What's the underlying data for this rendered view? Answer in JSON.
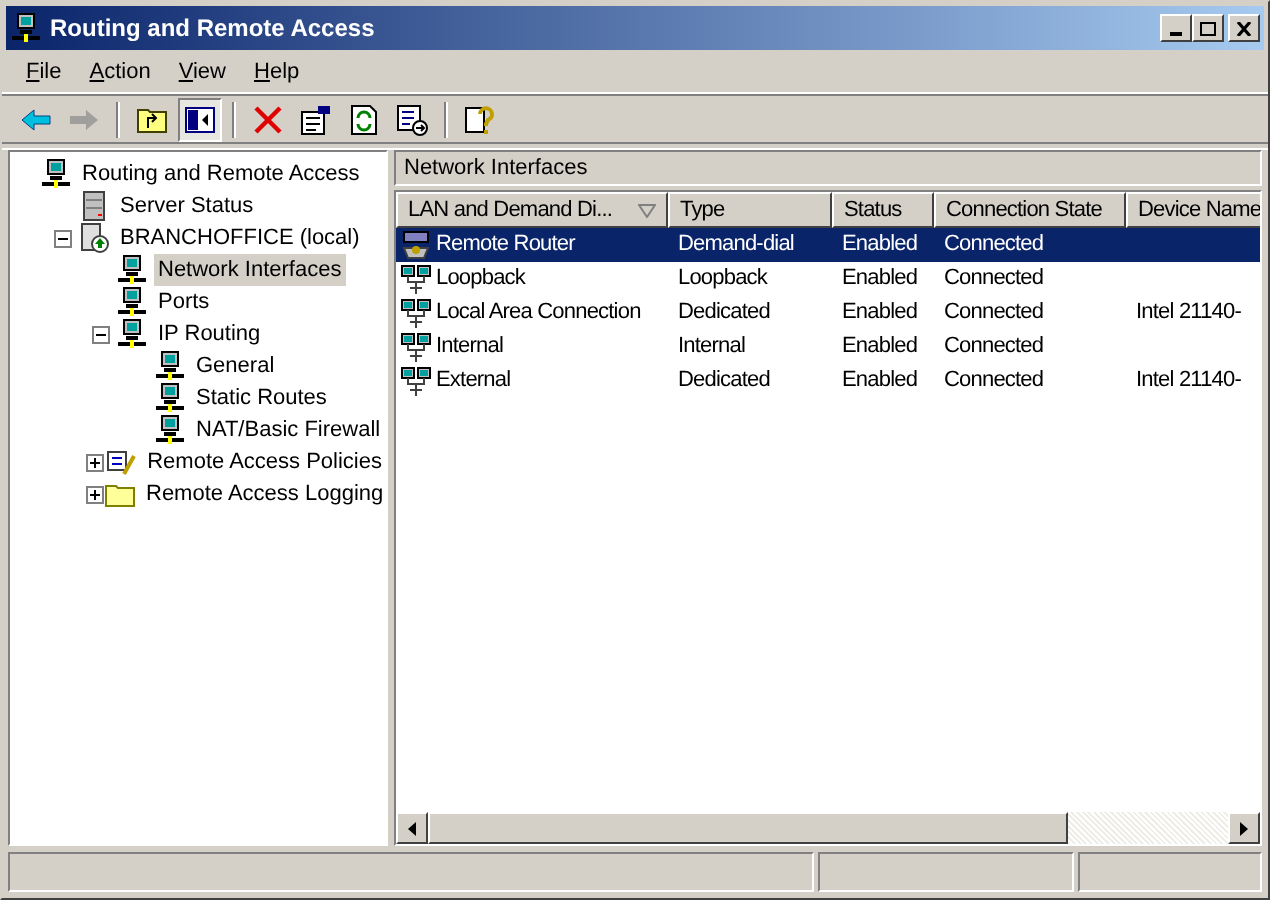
{
  "window": {
    "title": "Routing and Remote Access"
  },
  "menu": [
    {
      "hotkey": "F",
      "rest": "ile"
    },
    {
      "hotkey": "A",
      "rest": "ction"
    },
    {
      "hotkey": "V",
      "rest": "iew"
    },
    {
      "hotkey": "H",
      "rest": "elp"
    }
  ],
  "toolbar": [
    {
      "kind": "back",
      "disabled": false,
      "pressed": false
    },
    {
      "kind": "forward",
      "disabled": true,
      "pressed": false
    },
    {
      "kind": "sep"
    },
    {
      "kind": "up",
      "disabled": false,
      "pressed": false
    },
    {
      "kind": "tree",
      "disabled": false,
      "pressed": true
    },
    {
      "kind": "sep"
    },
    {
      "kind": "delete",
      "disabled": false,
      "pressed": false
    },
    {
      "kind": "properties",
      "disabled": false,
      "pressed": false
    },
    {
      "kind": "refresh",
      "disabled": false,
      "pressed": false
    },
    {
      "kind": "export",
      "disabled": false,
      "pressed": false
    },
    {
      "kind": "sep"
    },
    {
      "kind": "help",
      "disabled": false,
      "pressed": false
    }
  ],
  "tree": [
    {
      "label": "Routing and Remote Access",
      "kind": "computer",
      "selected": false,
      "children": [
        {
          "label": "Server Status",
          "kind": "server",
          "selected": false
        },
        {
          "label": "BRANCHOFFICE (local)",
          "kind": "local",
          "selected": false,
          "expanded": true,
          "children": [
            {
              "label": "Network Interfaces",
              "kind": "network",
              "selected": true
            },
            {
              "label": "Ports",
              "kind": "network",
              "selected": false
            },
            {
              "label": "IP Routing",
              "kind": "network",
              "selected": false,
              "expanded": true,
              "children": [
                {
                  "label": "General",
                  "kind": "network",
                  "selected": false
                },
                {
                  "label": "Static Routes",
                  "kind": "network",
                  "selected": false
                },
                {
                  "label": "NAT/Basic Firewall",
                  "kind": "network",
                  "selected": false
                }
              ]
            },
            {
              "label": "Remote Access Policies",
              "kind": "policy",
              "selected": false,
              "expanded": false
            },
            {
              "label": "Remote Access Logging",
              "kind": "folder",
              "selected": false,
              "expanded": false
            }
          ]
        }
      ]
    }
  ],
  "pane_title": "Network Interfaces",
  "table": {
    "columns": [
      "LAN and Demand Di...",
      "Type",
      "Status",
      "Connection State",
      "Device Name"
    ],
    "rows": [
      {
        "kind": "demand",
        "selected": true,
        "cells": [
          "Remote Router",
          "Demand-dial",
          "Enabled",
          "Connected",
          ""
        ]
      },
      {
        "kind": "lan",
        "selected": false,
        "cells": [
          "Loopback",
          "Loopback",
          "Enabled",
          "Connected",
          ""
        ]
      },
      {
        "kind": "lan",
        "selected": false,
        "cells": [
          "Local Area Connection",
          "Dedicated",
          "Enabled",
          "Connected",
          "Intel 21140-"
        ]
      },
      {
        "kind": "lan",
        "selected": false,
        "cells": [
          "Internal",
          "Internal",
          "Enabled",
          "Connected",
          ""
        ]
      },
      {
        "kind": "lan",
        "selected": false,
        "cells": [
          "External",
          "Dedicated",
          "Enabled",
          "Connected",
          "Intel 21140-"
        ]
      }
    ]
  }
}
